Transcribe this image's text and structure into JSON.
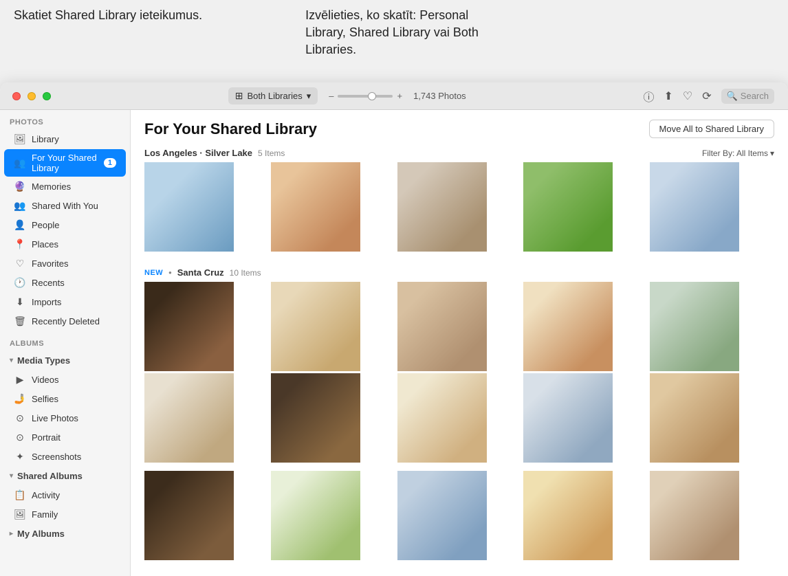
{
  "tooltip": {
    "left": "Skatiet Shared Library ieteikumus.",
    "right": "Izvēlieties, ko skatīt: Personal Library, Shared Library vai Both Libraries."
  },
  "titlebar": {
    "library_selector": "Both Libraries",
    "photo_count": "1,743 Photos",
    "search_placeholder": "Search"
  },
  "sidebar": {
    "photos_section": "Photos",
    "albums_section": "Albums",
    "items": [
      {
        "id": "library",
        "label": "Library",
        "icon": "🖼"
      },
      {
        "id": "for-your-shared-library",
        "label": "For Your Shared Library",
        "icon": "👥",
        "badge": "1",
        "active": true
      },
      {
        "id": "memories",
        "label": "Memories",
        "icon": "🔮"
      },
      {
        "id": "shared-with-you",
        "label": "Shared With You",
        "icon": "👥"
      },
      {
        "id": "people",
        "label": "People",
        "icon": "👤"
      },
      {
        "id": "places",
        "label": "Places",
        "icon": "📍"
      },
      {
        "id": "favorites",
        "label": "Favorites",
        "icon": "♡"
      },
      {
        "id": "recents",
        "label": "Recents",
        "icon": "🕐"
      },
      {
        "id": "imports",
        "label": "Imports",
        "icon": "⬇"
      },
      {
        "id": "recently-deleted",
        "label": "Recently Deleted",
        "icon": "🗑"
      }
    ],
    "media_types_group": "Media Types",
    "media_items": [
      {
        "id": "videos",
        "label": "Videos",
        "icon": "▶"
      },
      {
        "id": "selfies",
        "label": "Selfies",
        "icon": "🤳"
      },
      {
        "id": "live-photos",
        "label": "Live Photos",
        "icon": "⊙"
      },
      {
        "id": "portrait",
        "label": "Portrait",
        "icon": "⊙"
      },
      {
        "id": "screenshots",
        "label": "Screenshots",
        "icon": "✦"
      }
    ],
    "shared_albums_group": "Shared Albums",
    "shared_items": [
      {
        "id": "activity",
        "label": "Activity",
        "icon": "📋"
      },
      {
        "id": "family",
        "label": "Family",
        "icon": "🖼"
      }
    ],
    "my_albums_group": "My Albums"
  },
  "main": {
    "title": "For Your Shared Library",
    "move_button": "Move All to Shared Library",
    "filter_label": "Filter By: All Items",
    "section1": {
      "location": "Los Angeles · Silver Lake",
      "count": "5 Items"
    },
    "section2": {
      "new_label": "NEW",
      "location": "Santa Cruz",
      "count": "10 Items"
    }
  }
}
